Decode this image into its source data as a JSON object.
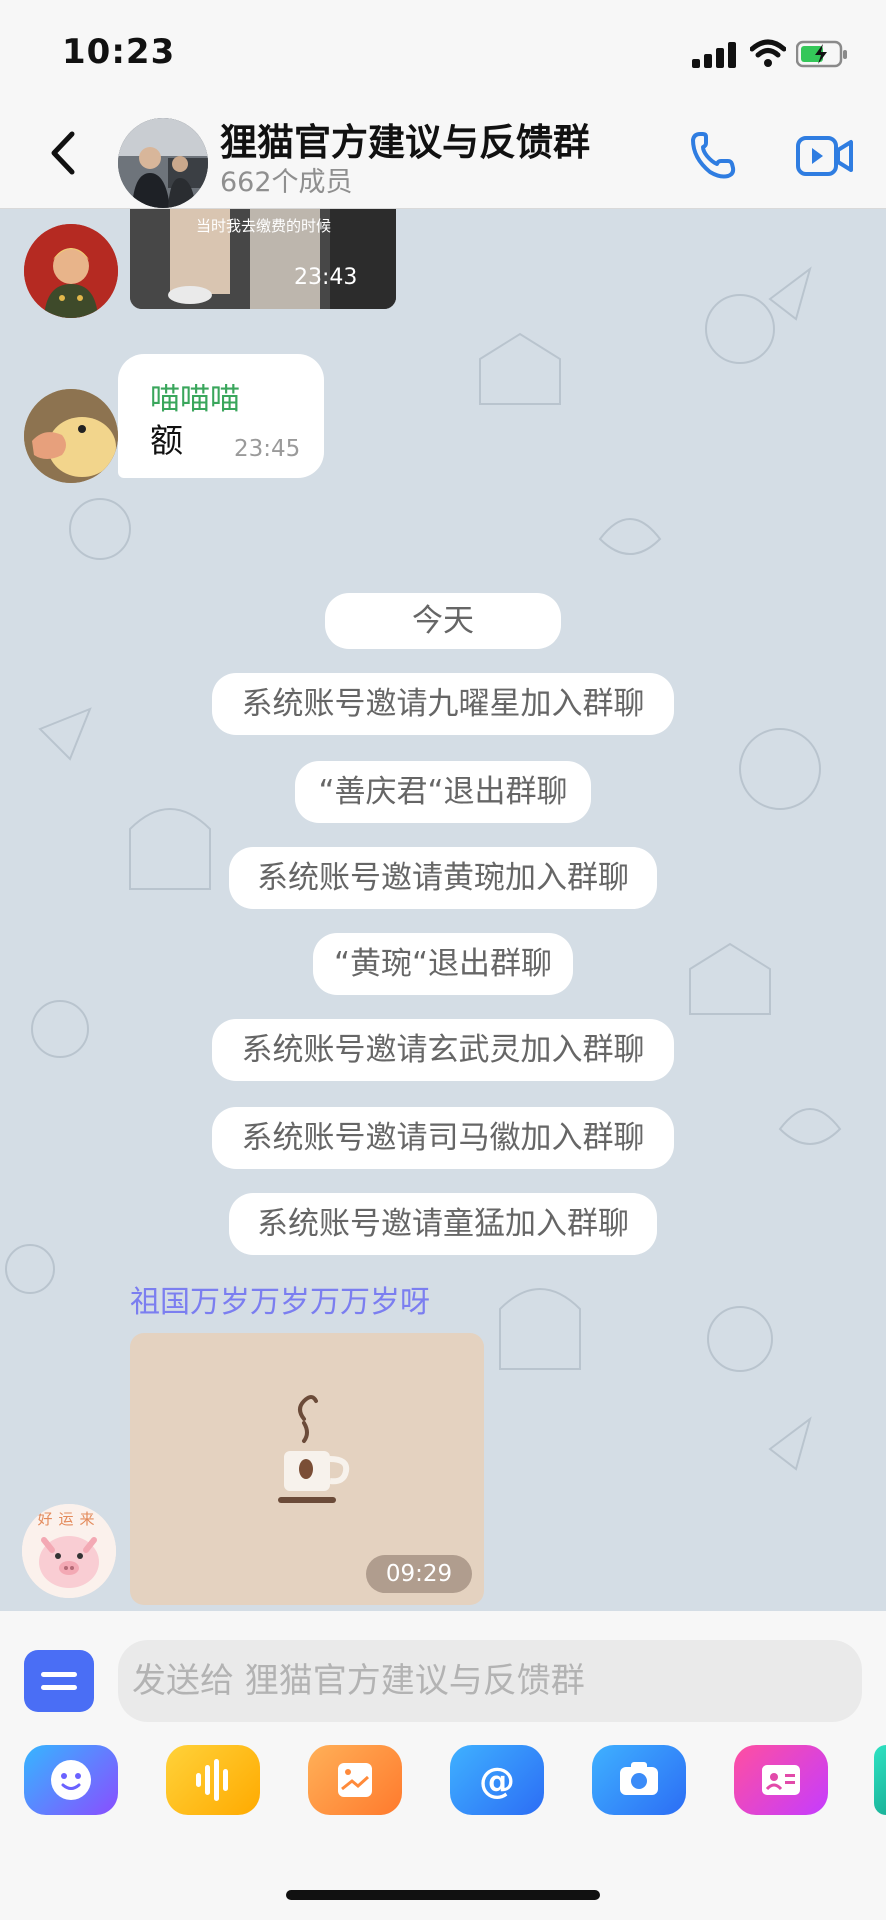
{
  "status_bar": {
    "time": "10:23"
  },
  "header": {
    "title": "狸猫官方建议与反馈群",
    "members": "662个成员"
  },
  "messages": {
    "top_image_caption": "当时我去缴费的时候",
    "top_image_time": "23:43",
    "msg1": {
      "sender": "喵喵喵",
      "text": "额",
      "time": "23:45",
      "sender_color": "#3aa65c"
    },
    "day_divider": "今天",
    "system": [
      "系统账号邀请九曜星加入群聊",
      "“善庆君“退出群聊",
      "系统账号邀请黄琬加入群聊",
      "“黄琬“退出群聊",
      "系统账号邀请玄武灵加入群聊",
      "系统账号邀请司马徽加入群聊",
      "系统账号邀请童猛加入群聊"
    ],
    "msg2": {
      "sender": "祖国万岁万岁万万岁呀",
      "time": "09:29",
      "sender_color": "#7b7ef0"
    },
    "pig_avatar_text": "好运来"
  },
  "input": {
    "placeholder": "发送给 狸猫官方建议与反馈群"
  },
  "toolbar": {
    "icons": [
      "emoji-icon",
      "voice-icon",
      "image-icon",
      "mention-icon",
      "camera-icon",
      "contact-card-icon"
    ]
  },
  "colors": {
    "accent": "#2f7de1",
    "chat_bg": "#d4dde5"
  }
}
